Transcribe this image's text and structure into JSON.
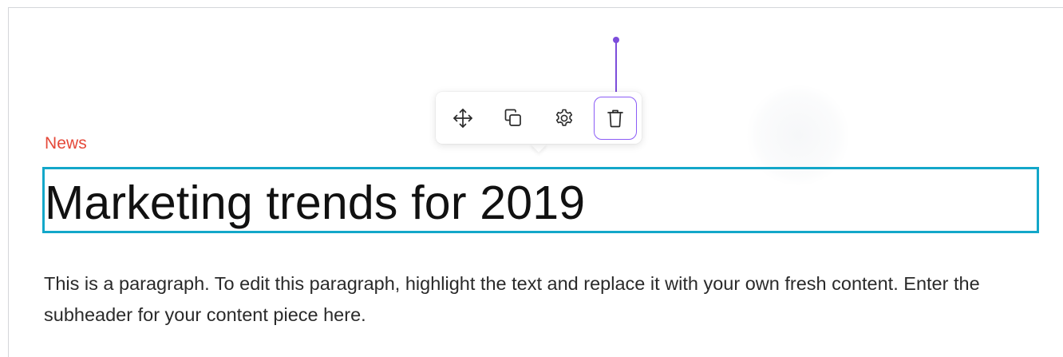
{
  "toolbar": {
    "buttons": [
      {
        "icon": "move-icon",
        "active": false
      },
      {
        "icon": "duplicate-icon",
        "active": false
      },
      {
        "icon": "settings-icon",
        "active": false
      },
      {
        "icon": "delete-icon",
        "active": true
      }
    ],
    "accent_color": "#8b5cf6"
  },
  "content": {
    "tag": "News",
    "title": "Marketing trends for 2019",
    "paragraph": "This is a paragraph. To edit this paragraph, highlight the text and replace it with your own fresh content. Enter the subheader for your content piece here."
  },
  "colors": {
    "tag": "#e5493a",
    "selection_border": "#13a7c9",
    "connector": "#7c4ddb"
  }
}
